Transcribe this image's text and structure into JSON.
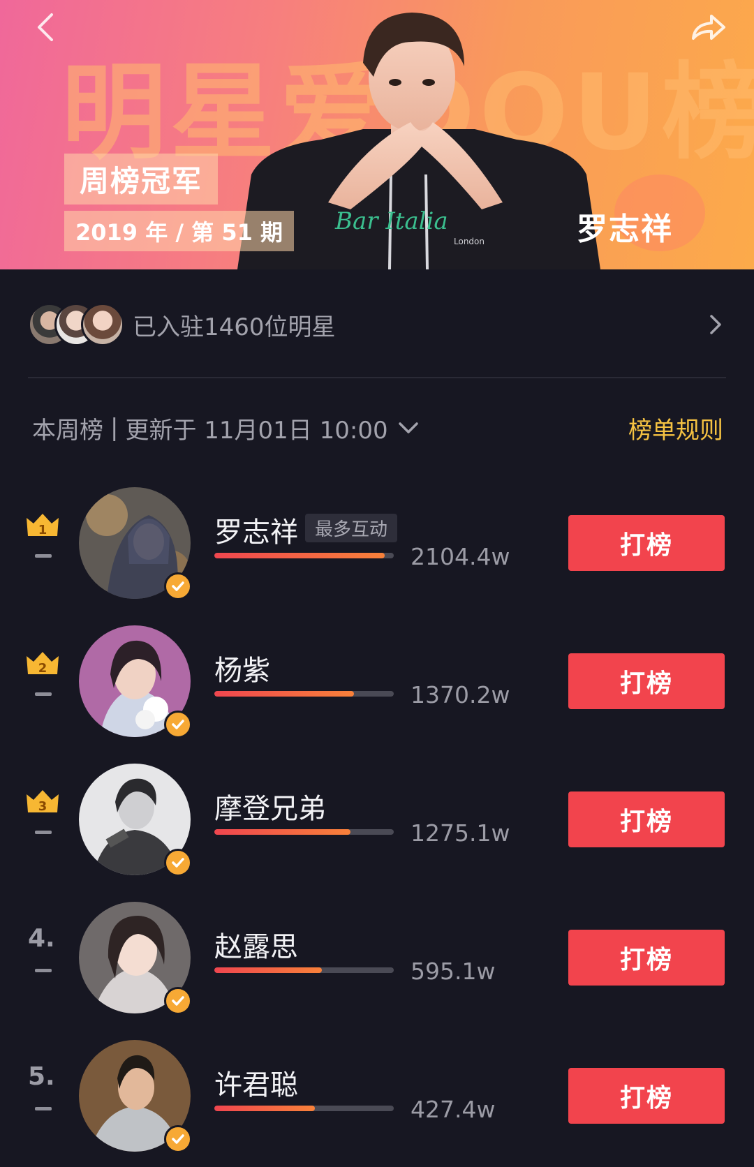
{
  "banner": {
    "title": "明星爱DOU榜",
    "champion_label": "周榜冠军",
    "period": "2019 年 / 第 51 期",
    "winner_name": "罗志祥",
    "shirt_text": "Bar Italia",
    "shirt_subtext": "London"
  },
  "settled": {
    "text": "已入驻1460位明星"
  },
  "week": {
    "label": "本周榜",
    "separator": "|",
    "updated": "更新于 11月01日 10:00",
    "rules_label": "榜单规则"
  },
  "colors": {
    "accent_button": "#f2444d",
    "rules_link": "#f5c242",
    "crown": "#f7b733",
    "background": "#171722"
  },
  "rankings": [
    {
      "rank": "1",
      "name": "罗志祥",
      "tag": "最多互动",
      "score": "2104.4w",
      "progress": 0.95,
      "button": "打榜",
      "badge": "crown-gold-icon"
    },
    {
      "rank": "2",
      "name": "杨紫",
      "tag": "",
      "score": "1370.2w",
      "progress": 0.78,
      "button": "打榜",
      "badge": "crown-icon"
    },
    {
      "rank": "3",
      "name": "摩登兄弟",
      "tag": "",
      "score": "1275.1w",
      "progress": 0.76,
      "button": "打榜",
      "badge": "crown-icon"
    },
    {
      "rank": "4.",
      "name": "赵露思",
      "tag": "",
      "score": "595.1w",
      "progress": 0.6,
      "button": "打榜",
      "badge": ""
    },
    {
      "rank": "5.",
      "name": "许君聪",
      "tag": "",
      "score": "427.4w",
      "progress": 0.56,
      "button": "打榜",
      "badge": ""
    }
  ]
}
